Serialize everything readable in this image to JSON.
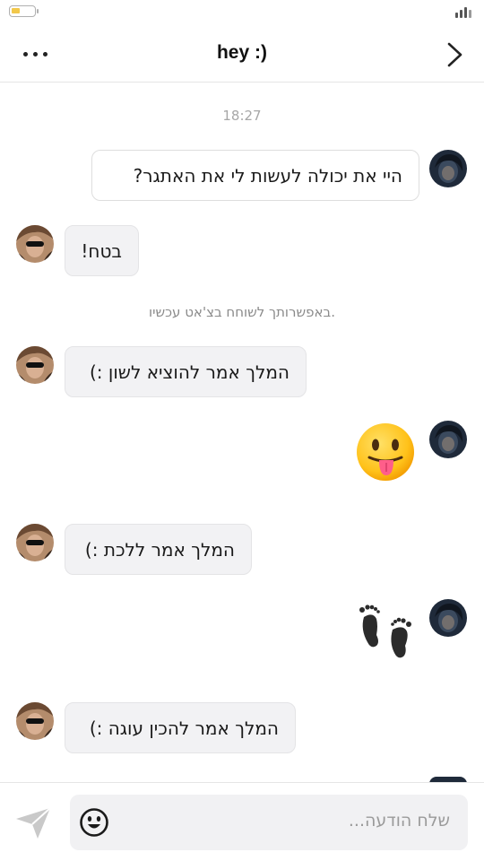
{
  "header": {
    "title": "hey :)",
    "more_icon": "ellipsis-icon",
    "forward_icon": "chevron-right-icon"
  },
  "chat": {
    "timestamp": "18:27",
    "notice": "באפשרותך לשוחח בצ'אט עכשיו.",
    "messages": [
      {
        "from": "me",
        "text": "היי את יכולה לעשות לי את האתגר?"
      },
      {
        "from": "them",
        "text": "בטח!"
      },
      {
        "from": "them",
        "text": "המלך אמר להוציא לשון :)"
      },
      {
        "from": "me",
        "emoji": "tongue-out-face-emoji"
      },
      {
        "from": "them",
        "text": "המלך אמר ללכת :)"
      },
      {
        "from": "me",
        "emoji": "footprints-emoji"
      },
      {
        "from": "them",
        "text": "המלך אמר להכין עוגה :)"
      }
    ]
  },
  "composer": {
    "placeholder": "שלח הודעה...",
    "send_icon": "paper-plane-icon",
    "emoji_icon": "smiley-icon"
  },
  "colors": {
    "incoming_bubble": "#f2f2f4",
    "outgoing_bubble": "#ffffff",
    "muted_text": "#a7a7a7"
  }
}
